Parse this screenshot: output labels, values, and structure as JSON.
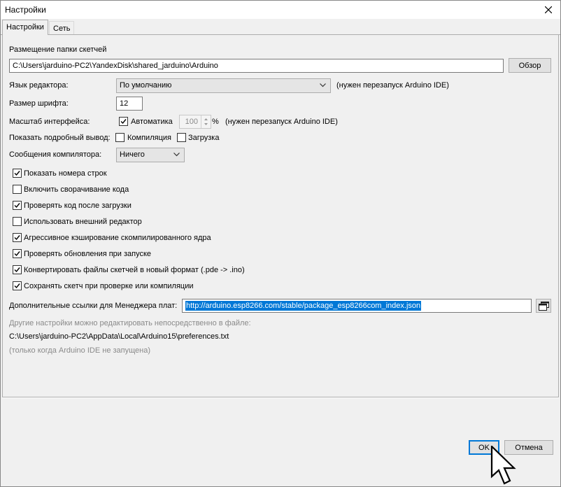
{
  "window": {
    "title": "Настройки",
    "close_icon": "close-icon"
  },
  "tabs": [
    {
      "label": "Настройки",
      "active": true
    },
    {
      "label": "Сеть",
      "active": false
    }
  ],
  "sketchbook": {
    "label": "Размещение папки скетчей",
    "path": "C:\\Users\\jarduino-PC2\\YandexDisk\\shared_jarduino\\Arduino",
    "browse_label": "Обзор"
  },
  "editor_language": {
    "label": "Язык редактора:",
    "value": "По умолчанию",
    "note": "(нужен перезапуск Arduino IDE)"
  },
  "font_size": {
    "label": "Размер шрифта:",
    "value": "12"
  },
  "interface_scale": {
    "label": "Масштаб интерфейса:",
    "auto_label": "Автоматика",
    "auto_checked": true,
    "value": "100",
    "unit": "%",
    "note": "(нужен перезапуск Arduino IDE)"
  },
  "verbose_output": {
    "label": "Показать подробный вывод:",
    "compile_label": "Компиляция",
    "compile_checked": false,
    "upload_label": "Загрузка",
    "upload_checked": false
  },
  "compiler_warnings": {
    "label": "Сообщения компилятора:",
    "value": "Ничего"
  },
  "options": [
    {
      "label": "Показать номера строк",
      "checked": true
    },
    {
      "label": "Включить сворачивание кода",
      "checked": false
    },
    {
      "label": "Проверять код после загрузки",
      "checked": true
    },
    {
      "label": "Использовать внешний редактор",
      "checked": false
    },
    {
      "label": "Агрессивное кэширование скомпилированного ядра",
      "checked": true
    },
    {
      "label": "Проверять обновления при запуске",
      "checked": true
    },
    {
      "label": "Конвертировать файлы скетчей в новый формат (.pde -> .ino)",
      "checked": true
    },
    {
      "label": "Сохранять скетч при проверке или компиляции",
      "checked": true
    }
  ],
  "board_manager": {
    "label": "Дополнительные ссылки для Менеджера плат:",
    "url": "http://arduino.esp8266.com/stable/package_esp8266com_index.json",
    "button_icon": "window-list-icon"
  },
  "prefs_info": {
    "hint": "Другие настройки можно редактировать непосредственно в файле:",
    "path": "C:\\Users\\jarduino-PC2\\AppData\\Local\\Arduino15\\preferences.txt",
    "note": "(только когда Arduino IDE не запущена)"
  },
  "footer": {
    "ok_label": "OK",
    "cancel_label": "Отмена"
  }
}
